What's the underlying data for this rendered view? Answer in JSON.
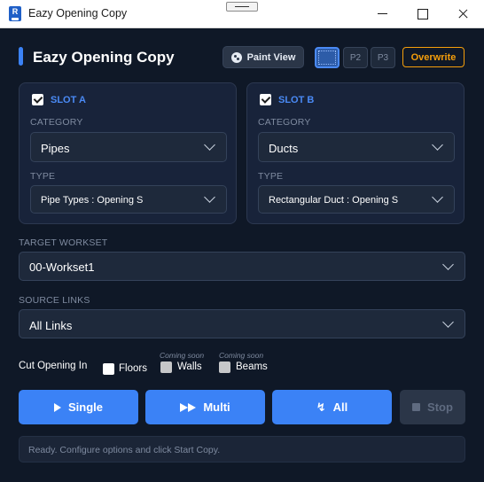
{
  "window": {
    "title": "Eazy Opening Copy",
    "icon_letter": "R"
  },
  "header": {
    "title": "Eazy Opening Copy",
    "paint_view_label": "Paint View",
    "presets": [
      "P1",
      "P2",
      "P3"
    ],
    "overwrite_label": "Overwrite"
  },
  "slot_a": {
    "title": "SLOT A",
    "checked": true,
    "category_label": "CATEGORY",
    "category_value": "Pipes",
    "type_label": "TYPE",
    "type_value": "Pipe Types : Opening S"
  },
  "slot_b": {
    "title": "SLOT B",
    "checked": true,
    "category_label": "CATEGORY",
    "category_value": "Ducts",
    "type_label": "TYPE",
    "type_value": "Rectangular Duct : Opening S"
  },
  "target_workset": {
    "label": "TARGET WORKSET",
    "value": "00-Workset1"
  },
  "source_links": {
    "label": "SOURCE LINKS",
    "value": "All Links"
  },
  "cut_opening": {
    "label": "Cut Opening In",
    "options": [
      {
        "label": "Floors",
        "note": "",
        "checked": false
      },
      {
        "label": "Walls",
        "note": "Coming soon",
        "checked": false
      },
      {
        "label": "Beams",
        "note": "Coming soon",
        "checked": false
      }
    ]
  },
  "actions": {
    "single": "Single",
    "multi": "Multi",
    "all": "All",
    "stop": "Stop"
  },
  "status": {
    "text": "Ready. Configure options and click Start Copy."
  },
  "colors": {
    "background": "#0f1827",
    "panel": "#18233a",
    "accent": "#3b82f6",
    "warning": "#f59e0b",
    "muted": "#7f8ba0"
  },
  "icons": {
    "paint_view": "palette-icon",
    "single": "play-icon",
    "multi": "fast-forward-icon",
    "all": "lightning-icon",
    "stop": "stop-icon",
    "dropdown": "chevron-down-icon"
  }
}
